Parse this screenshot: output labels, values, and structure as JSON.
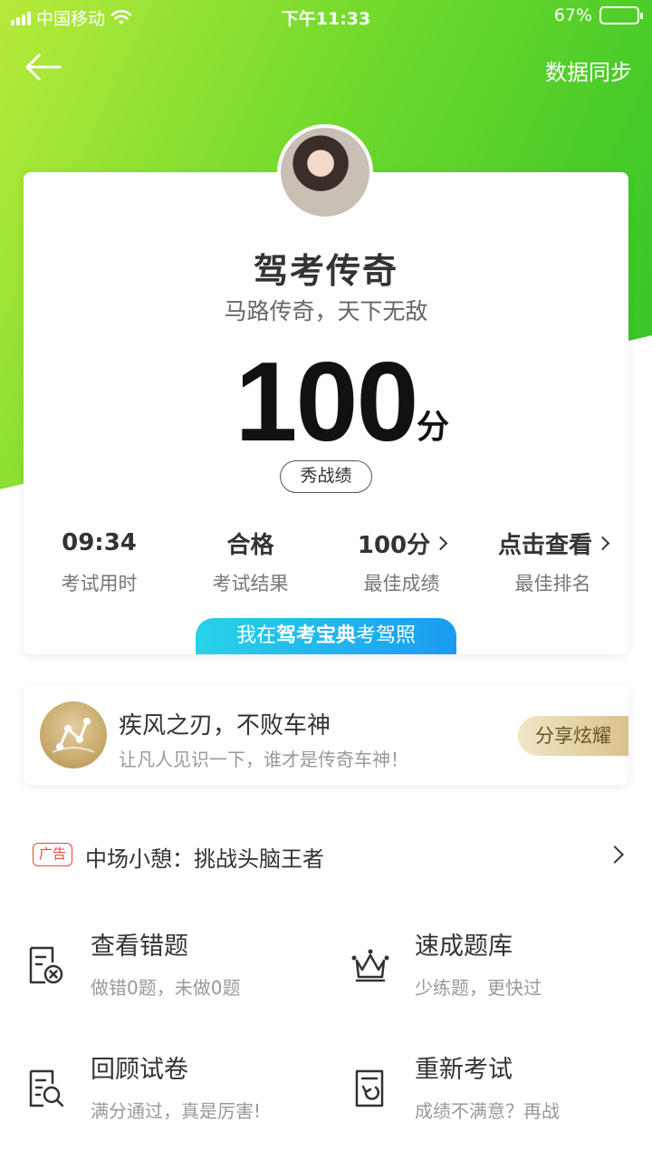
{
  "status_bar": {
    "carrier": "中国移动",
    "time": "下午11:33",
    "battery_percent": "67%",
    "battery_level": 0.67
  },
  "header": {
    "back_icon": "arrow-left-icon",
    "sync_label": "数据同步"
  },
  "profile": {
    "title": "驾考传奇",
    "subtitle": "马路传奇，天下无敌",
    "score": "100",
    "score_unit": "分",
    "show_button": "秀战绩"
  },
  "stats": [
    {
      "value": "09:34",
      "label": "考试用时",
      "chevron": false
    },
    {
      "value": "合格",
      "label": "考试结果",
      "chevron": false
    },
    {
      "value": "100分",
      "label": "最佳成绩",
      "chevron": true
    },
    {
      "value": "点击查看",
      "label": "最佳排名",
      "chevron": true
    }
  ],
  "promo": {
    "prefix": "我在",
    "brand": "驾考宝典",
    "suffix": "考驾照"
  },
  "share": {
    "icon": "trophy-chart-icon",
    "title": "疾风之刃，不败车神",
    "description": "让凡人见识一下，谁才是传奇车神！",
    "button": "分享炫耀"
  },
  "ad": {
    "badge": "广告",
    "text": "中场小憩：挑战头脑王者"
  },
  "actions": [
    {
      "title": "查看错题",
      "desc": "做错0题，未做0题",
      "icon": "wrong-questions-icon"
    },
    {
      "title": "速成题库",
      "desc": "少练题，更快过",
      "icon": "crown-icon"
    },
    {
      "title": "回顾试卷",
      "desc": "满分通过，真是厉害!",
      "icon": "review-paper-icon"
    },
    {
      "title": "重新考试",
      "desc": "成绩不满意？再战",
      "icon": "retake-exam-icon"
    }
  ],
  "colors": {
    "header_gradient_start": "#b7ea3a",
    "header_gradient_end": "#2fc227",
    "promo_gradient_start": "#27d3e8",
    "promo_gradient_end": "#1b9bf0",
    "ad_badge": "#e5483f",
    "share_button_gold": "#d9c38c"
  }
}
